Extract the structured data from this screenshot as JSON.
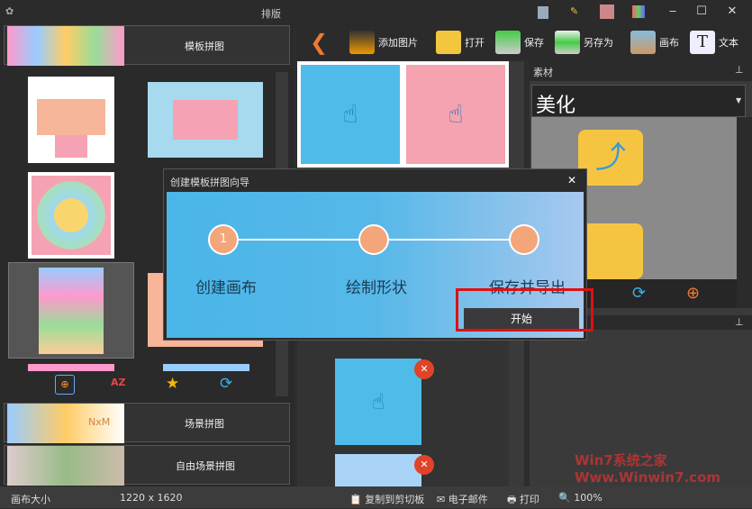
{
  "window": {
    "title": "排版",
    "minimize": "‒",
    "maximize": "☐",
    "close": "✕"
  },
  "left_panel": {
    "template_header": "模板拼图",
    "scene_header": "场景拼图",
    "free_scene_header": "自由场景拼图",
    "thumb_text": "NxM"
  },
  "toolbar": {
    "add_image": "添加图片",
    "open": "打开",
    "save": "保存",
    "save_as": "另存为",
    "canvas": "画布",
    "text": "文本"
  },
  "right_panel": {
    "material_label": "素材",
    "category": "美化",
    "pin": "⊥"
  },
  "dialog": {
    "title": "创建模板拼图向导",
    "close": "✕",
    "step1_number": "1",
    "steps": [
      "创建画布",
      "绘制形状",
      "保存并导出"
    ],
    "start": "开始"
  },
  "status": {
    "canvas_size_label": "画布大小",
    "canvas_size": "1220 x 1620",
    "copy": "复制到剪切板",
    "email": "电子邮件",
    "print": "打印",
    "zoom": "100%"
  },
  "watermark": "Win7系统之家 Www.Winwin7.com"
}
